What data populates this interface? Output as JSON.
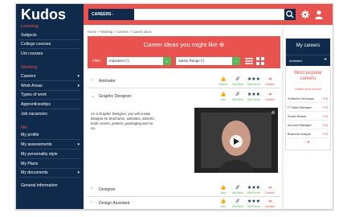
{
  "logo": "Kudos",
  "sidebar": {
    "sections": [
      {
        "title": "Learning",
        "items": [
          {
            "label": "Subjects",
            "arrow": false
          },
          {
            "label": "College courses",
            "arrow": false
          },
          {
            "label": "Uni courses",
            "arrow": false
          }
        ]
      },
      {
        "title": "Working",
        "items": [
          {
            "label": "Careers",
            "arrow": true
          },
          {
            "label": "Work Areas",
            "arrow": true
          },
          {
            "label": "Types of work",
            "arrow": false
          },
          {
            "label": "Apprenticeships",
            "arrow": false
          },
          {
            "label": "Job vacancies",
            "arrow": false
          }
        ]
      },
      {
        "title": "Me",
        "items": [
          {
            "label": "My profile",
            "arrow": false
          },
          {
            "label": "My assessments",
            "arrow": true
          },
          {
            "label": "My personality style",
            "arrow": false
          },
          {
            "label": "My Plans",
            "arrow": false
          },
          {
            "label": "My documents",
            "arrow": true
          },
          {
            "label": "General information",
            "arrow": false
          }
        ]
      }
    ]
  },
  "topbar": {
    "search_select": "CAREERS -",
    "search_placeholder": ""
  },
  "breadcrumb": "Home > Working > Careers > Career ideas",
  "main": {
    "title": "Career ideas you might like ⊕",
    "filter_label": "Filter",
    "filter_industries": "Industries (*)",
    "filter_salary": "Salary Range (*)",
    "actions": {
      "add": "Add",
      "myskills": "MySkills",
      "myfuture": "MyFuture",
      "details": "Details",
      "added": "Added"
    },
    "rows": [
      {
        "title": "Animator",
        "added": true,
        "chevron": "›"
      },
      {
        "title": "Graphic Designer",
        "added": false,
        "chevron": "⌄"
      },
      {
        "title": "Designer",
        "added": false,
        "chevron": "›"
      },
      {
        "title": "Design Assistant",
        "added": false,
        "chevron": "›"
      }
    ],
    "description": "As a Graphic Designer, you will create designs for brochures, websites, adverts, book covers, posters, packaging and so on."
  },
  "right_panel": {
    "title": "My careers",
    "my_career": "Animator",
    "popular_title": "Most popular careers",
    "popular_sub": "Within your school",
    "popular_items": [
      "Software Developer",
      "IT Sales Manager",
      "Social Worker",
      "Account Manager",
      "Business Analyst"
    ]
  },
  "colors": {
    "accent": "#e8534f",
    "navy": "#0f2a4a",
    "green": "#5cb85c"
  }
}
